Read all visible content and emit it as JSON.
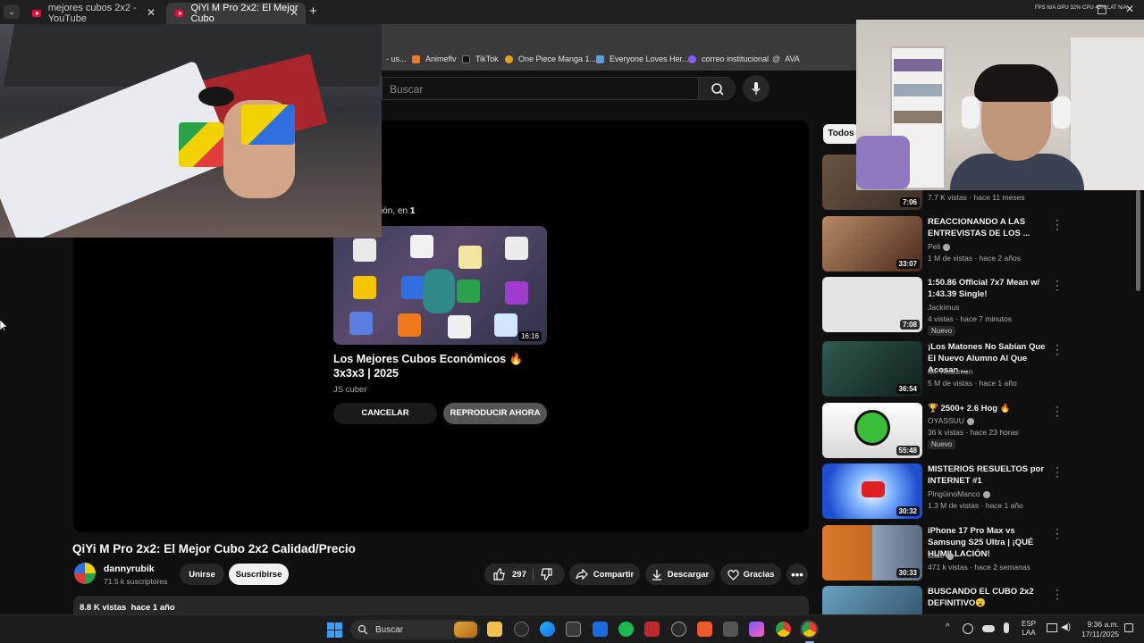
{
  "browser": {
    "tabs": [
      {
        "label": "mejores cubos 2x2 - YouTube",
        "active": false
      },
      {
        "label": "QiYi M Pro 2x2: El Mejor Cubo",
        "active": true
      }
    ],
    "bookmarks": [
      {
        "label": "- us...",
        "icon": "bookmark-icon",
        "color": "#d9a441"
      },
      {
        "label": "Animeflv",
        "icon": "animeflv-icon",
        "color": "#f27b22"
      },
      {
        "label": "TikTok",
        "icon": "tiktok-icon",
        "color": "#111111"
      },
      {
        "label": "One Piece Manga 1...",
        "icon": "onepiece-icon",
        "color": "#e5a21b"
      },
      {
        "label": "Everyone Loves Her...",
        "icon": "bookmark-icon",
        "color": "#5aa0e0"
      },
      {
        "label": "correo institucional",
        "icon": "mail-icon",
        "color": "#8b5cf6"
      },
      {
        "label": "AVA",
        "icon": "at-icon",
        "color": "#cccccc"
      }
    ]
  },
  "header": {
    "search_placeholder": "Buscar"
  },
  "player": {
    "upnext_prefix": "ión, en",
    "upnext_seconds": "1",
    "next_title": "Los Mejores Cubos Económicos 🔥 3x3x3 | 2025",
    "next_channel": "JS cuber",
    "next_duration": "16:16",
    "cancel_label": "CANCELAR",
    "play_now_label": "REPRODUCIR AHORA"
  },
  "video": {
    "title": "QiYi M Pro 2x2: El Mejor Cubo 2x2 Calidad/Precio",
    "channel": "dannyrubik",
    "subscribers": "71.5 k suscriptores",
    "join_label": "Unirse",
    "subscribe_label": "Suscribirse",
    "likes": "297",
    "share_label": "Compartir",
    "download_label": "Descargar",
    "thanks_label": "Gracias",
    "views": "8.8 K vistas",
    "age": "hace 1 año"
  },
  "sidebar": {
    "chip": "Todos",
    "items": [
      {
        "title": "",
        "channel": "",
        "views": "7.7 K vistas · hace 11 meses",
        "duration": "7:06",
        "badge": "",
        "verified": false,
        "thumb_color": "#5a4a3c"
      },
      {
        "title": "REACCIONANDO A LAS ENTREVISTAS DE LOS ...",
        "channel": "Peli",
        "views": "1 M de vistas · hace 2 años",
        "duration": "33:07",
        "badge": "",
        "verified": true,
        "thumb_color": "#7a5a3a"
      },
      {
        "title": "1:50.86 Official 7x7 Mean w/ 1:43.39 Single!",
        "channel": "Jackimus",
        "views": "4 vistas · hace 7 minutos",
        "duration": "7:08",
        "badge": "Nuevo",
        "verified": false,
        "thumb_color": "#dcdcdc"
      },
      {
        "title": "¡Los Matones No Sabían Que El Nuevo Alumno Al Que Acosan ...",
        "channel": "Mr. Resumen",
        "views": "5 M de vistas · hace 1 año",
        "duration": "36:54",
        "badge": "",
        "verified": false,
        "thumb_color": "#1f3a35"
      },
      {
        "title": "🏆 2500+ 2.6 Hog 🔥",
        "channel": "OYASSUU",
        "views": "36 k vistas · hace 23 horas",
        "duration": "55:48",
        "badge": "Nuevo",
        "verified": true,
        "thumb_color": "#e9e9e9"
      },
      {
        "title": "MISTERIOS RESUELTOS por INTERNET #1",
        "channel": "PingüinoManco",
        "views": "1.3 M de vistas · hace 1 año",
        "duration": "30:32",
        "badge": "",
        "verified": true,
        "thumb_color": "#1e5fe0"
      },
      {
        "title": "iPhone 17 Pro Max vs Samsung S25 Ultra | ¡QUÉ HUMILLACIÓN!",
        "channel": "Jade",
        "views": "471 k vistas · hace 2 semanas",
        "duration": "30:33",
        "badge": "",
        "verified": true,
        "thumb_color": "#d97a2b"
      },
      {
        "title": "BUSCANDO EL CUBO 2x2 DEFINITIVO😮",
        "channel": "",
        "views": "",
        "duration": "",
        "badge": "",
        "verified": false,
        "thumb_color": "#3a6a8a"
      }
    ]
  },
  "overlay": {
    "stats": "FPS N/A  GPU 32%  CPU 45%  LAT N/A"
  },
  "taskbar": {
    "search_label": "Buscar",
    "lang_top": "ESP",
    "lang_bottom": "LAA",
    "time": "9:36 a.m.",
    "date": "17/11/2025"
  }
}
